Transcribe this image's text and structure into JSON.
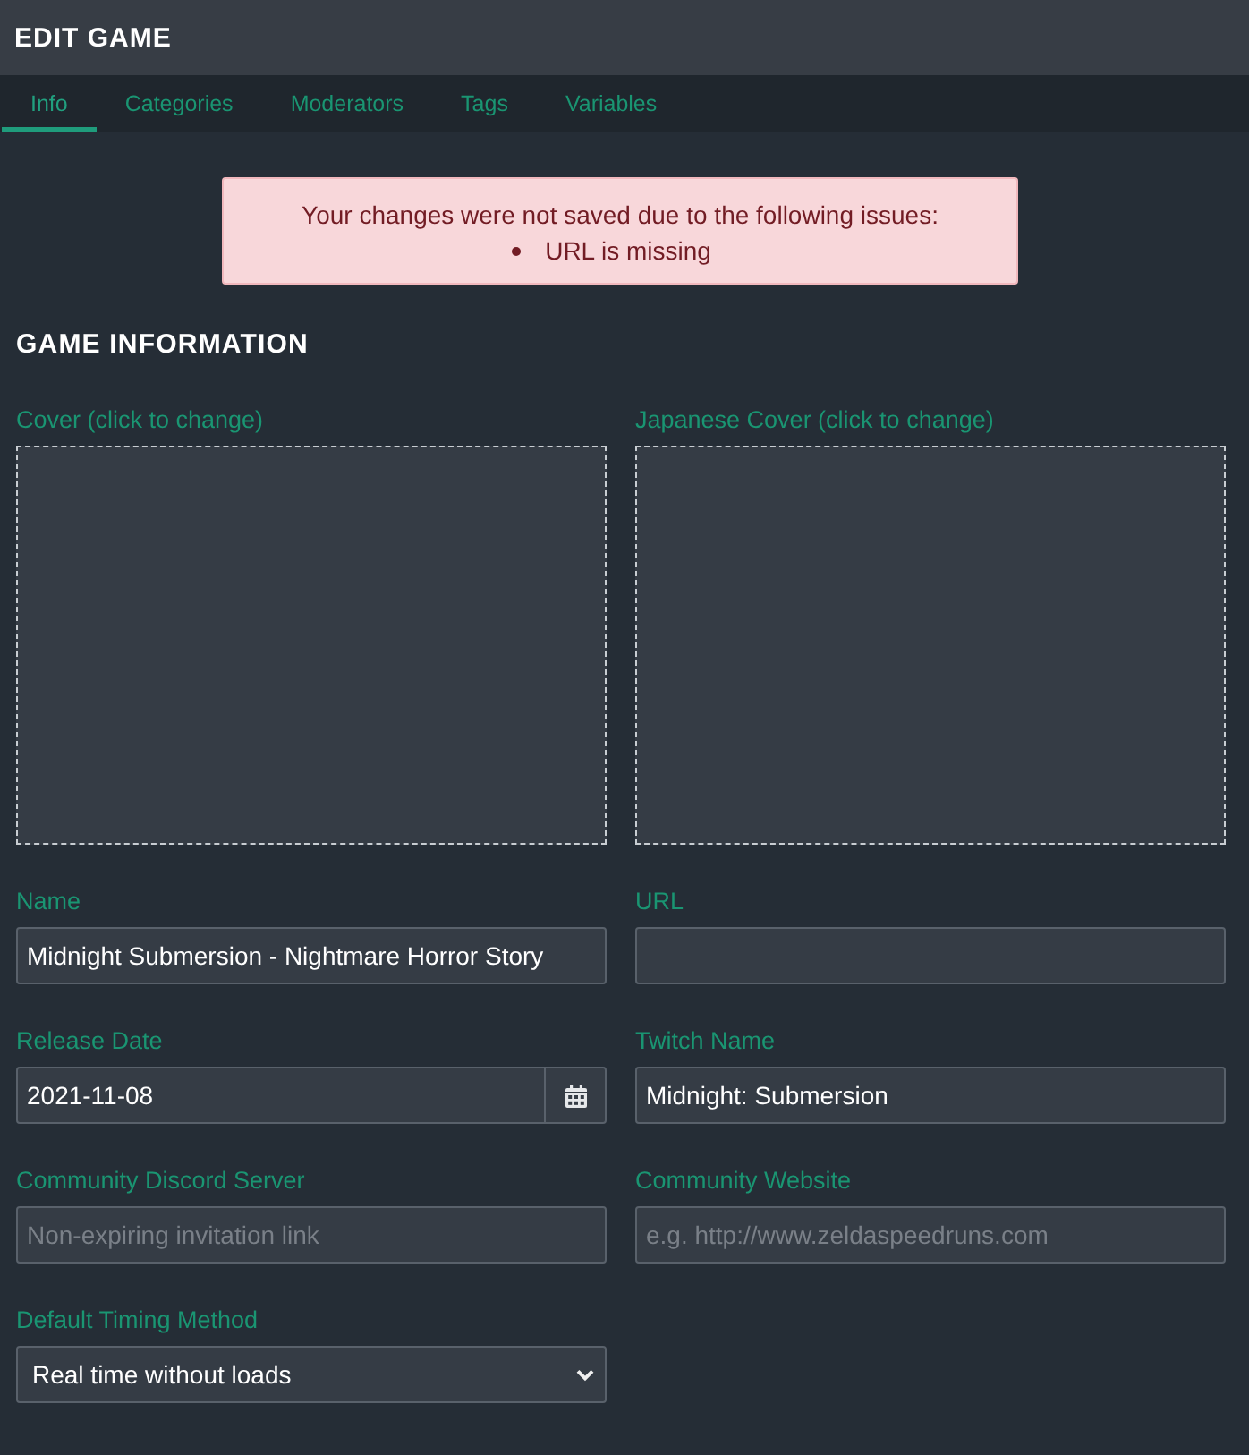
{
  "header": {
    "title": "EDIT GAME"
  },
  "tabs": [
    {
      "label": "Info",
      "selected": true
    },
    {
      "label": "Categories",
      "selected": false
    },
    {
      "label": "Moderators",
      "selected": false
    },
    {
      "label": "Tags",
      "selected": false
    },
    {
      "label": "Variables",
      "selected": false
    }
  ],
  "alert": {
    "message": "Your changes were not saved due to the following issues:",
    "issues": [
      "URL is missing"
    ]
  },
  "section": {
    "title": "GAME INFORMATION"
  },
  "covers": [
    {
      "label": "Cover (click to change)"
    },
    {
      "label": "Japanese Cover (click to change)"
    }
  ],
  "fields": [
    {
      "label": "Name",
      "kind": "text",
      "value": "Midnight Submersion - Nightmare Horror Story"
    },
    {
      "label": "URL",
      "kind": "text"
    },
    {
      "label": "Release Date",
      "kind": "date",
      "value": "2021-11-08"
    },
    {
      "label": "Twitch Name",
      "kind": "text",
      "value": "Midnight: Submersion"
    },
    {
      "label": "Community Discord Server",
      "kind": "text",
      "placeholder": "Non-expiring invitation link"
    },
    {
      "label": "Community Website",
      "kind": "text",
      "placeholder": "e.g. http://www.zeldaspeedruns.com"
    },
    {
      "label": "Default Timing Method",
      "kind": "select",
      "value": "Real time without loads"
    }
  ]
}
